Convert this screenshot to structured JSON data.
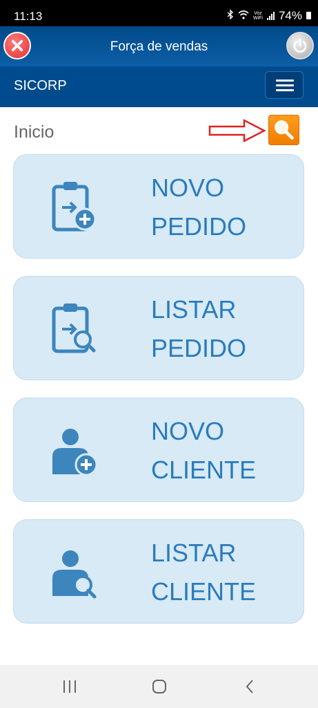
{
  "status_bar": {
    "time": "11:13",
    "voz_line1": "Voz",
    "voz_line2": "WiFi",
    "battery": "74%"
  },
  "header": {
    "title": "Força de vendas"
  },
  "navbar": {
    "brand": "SICORP"
  },
  "page": {
    "title": "Inicio"
  },
  "cards": [
    {
      "line1": "NOVO",
      "line2": "PEDIDO",
      "icon": "clipboard-plus-icon"
    },
    {
      "line1": "LISTAR",
      "line2": "PEDIDO",
      "icon": "clipboard-search-icon"
    },
    {
      "line1": "NOVO",
      "line2": "CLIENTE",
      "icon": "user-plus-icon"
    },
    {
      "line1": "LISTAR",
      "line2": "CLIENTE",
      "icon": "user-search-icon"
    }
  ],
  "colors": {
    "header": "#004b8d",
    "card_bg": "#d7eaf5",
    "card_text": "#2b7bbd",
    "search_button": "#f7890c",
    "arrow": "#e02020"
  }
}
